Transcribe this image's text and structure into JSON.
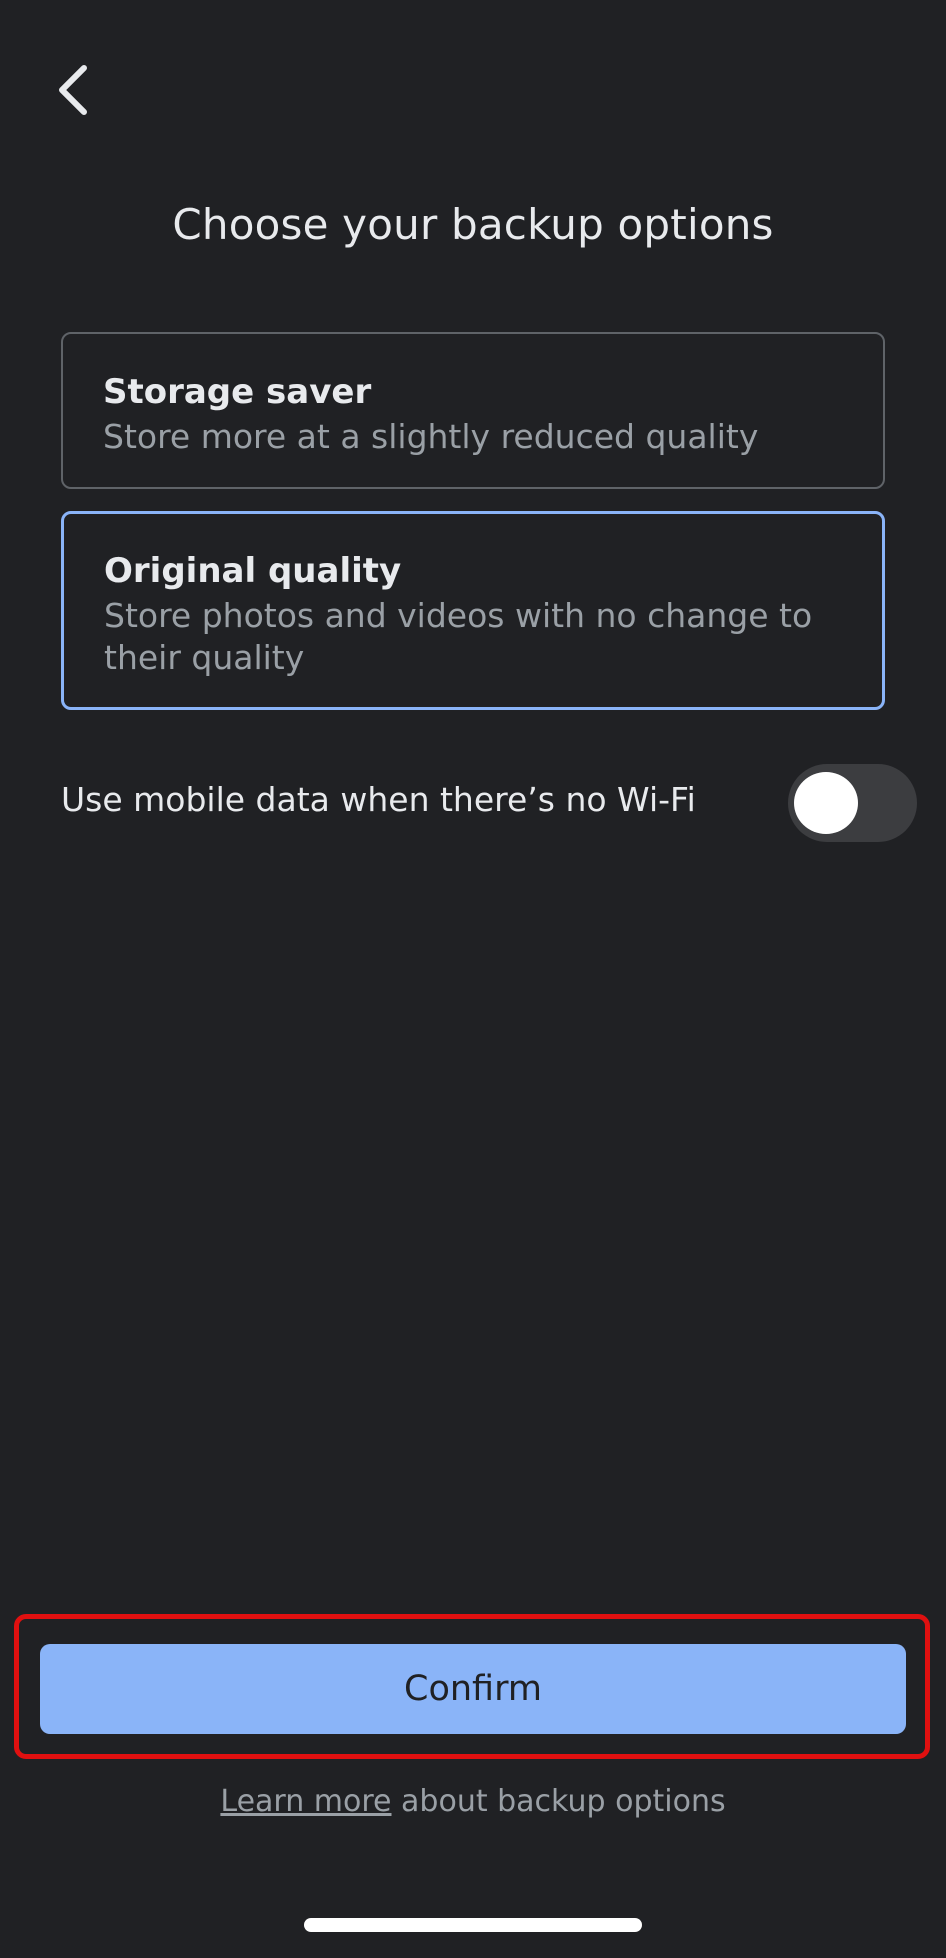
{
  "header": {
    "back_icon": "chevron-left-icon",
    "title": "Choose your backup options"
  },
  "options": [
    {
      "title": "Storage saver",
      "description": "Store more at a slightly reduced quality",
      "selected": false
    },
    {
      "title": "Original quality",
      "description": "Store photos and videos with no change to their quality",
      "selected": true
    }
  ],
  "mobile_data": {
    "label": "Use mobile data when there’s no Wi-Fi",
    "enabled": false
  },
  "confirm": {
    "label": "Confirm"
  },
  "learn_more": {
    "link_text": "Learn more",
    "suffix": " about backup options"
  },
  "colors": {
    "background": "#202124",
    "accent": "#8ab4f8",
    "highlight": "#e01010"
  }
}
